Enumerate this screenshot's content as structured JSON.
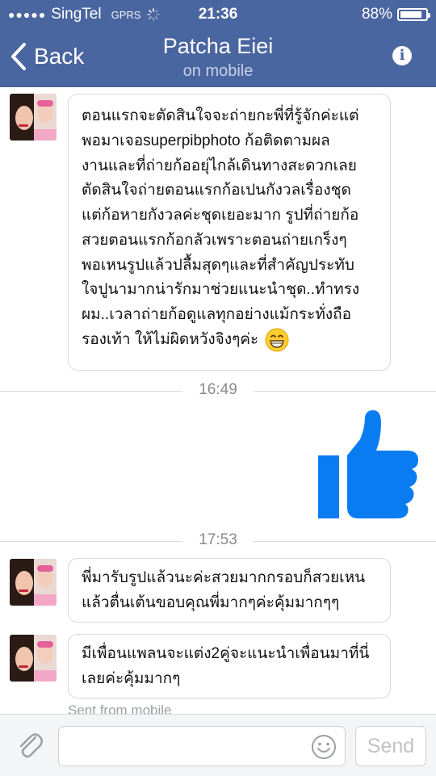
{
  "status_bar": {
    "signal_dots": "●●●●●",
    "carrier": "SingTel",
    "network": "GPRS",
    "time": "21:36",
    "battery_text": "88%",
    "battery_level": 0.88
  },
  "header": {
    "back_label": "Back",
    "title": "Patcha Eiei",
    "subtitle": "on mobile"
  },
  "messages": [
    {
      "lines": [
        "ตอนแรกจะตัดสินใจจะถ่ายกะพี่ที่รู้จักค่ะแต่",
        "พอมาเจอsuperpibphoto ก้อติดตามผล",
        "งานและที่ถ่ายก้ออยุ่ไกล้เดินทางสะดวกเลย",
        "ตัดสินใจถ่ายตอนแรกก้อเปนกังวลเรื่องชุด",
        "แต่ก้อหายกังวลค่ะชุดเยอะมาก รูปที่ถ่ายก้อ",
        "สวยตอนแรกก้อกลัวเพราะตอนถ่ายเกร็งๆ",
        "พอเหนรูปแล้วปลื้มสุดๆและที่สำคัญประทับ",
        "ใจปูนามากน่ารักมาช่วยแนะนำชุด..ทำทรง",
        "ผม..เวลาถ่ายก้อดูแลทุกอย่างแม้กระทั่งถือ",
        "รองเท้า ให้ไม่ผิดหวังจิงๆค่ะ"
      ],
      "emoji": "grinning-face"
    },
    {
      "lines": [
        "พี่มารับรูปแล้วนะค่ะสวยมากกรอบก็สวยเหน",
        "แล้วตื่นเต้นขอบคุณพี่มากๆค่ะคุ้มมากๆๆ"
      ]
    },
    {
      "lines": [
        "มีเพื่อนแพลนจะแต่ง2คู่จะแนะนำเพื่อนมาที่นี่",
        "เลยค่ะคุ้มมากๆ"
      ]
    }
  ],
  "timestamps": [
    "16:49",
    "17:53"
  ],
  "sent_note": "Sent from mobile",
  "composer": {
    "placeholder": "",
    "send_label": "Send"
  },
  "colors": {
    "header_bg": "#4a66a0",
    "like_blue": "#0a7cf2"
  }
}
